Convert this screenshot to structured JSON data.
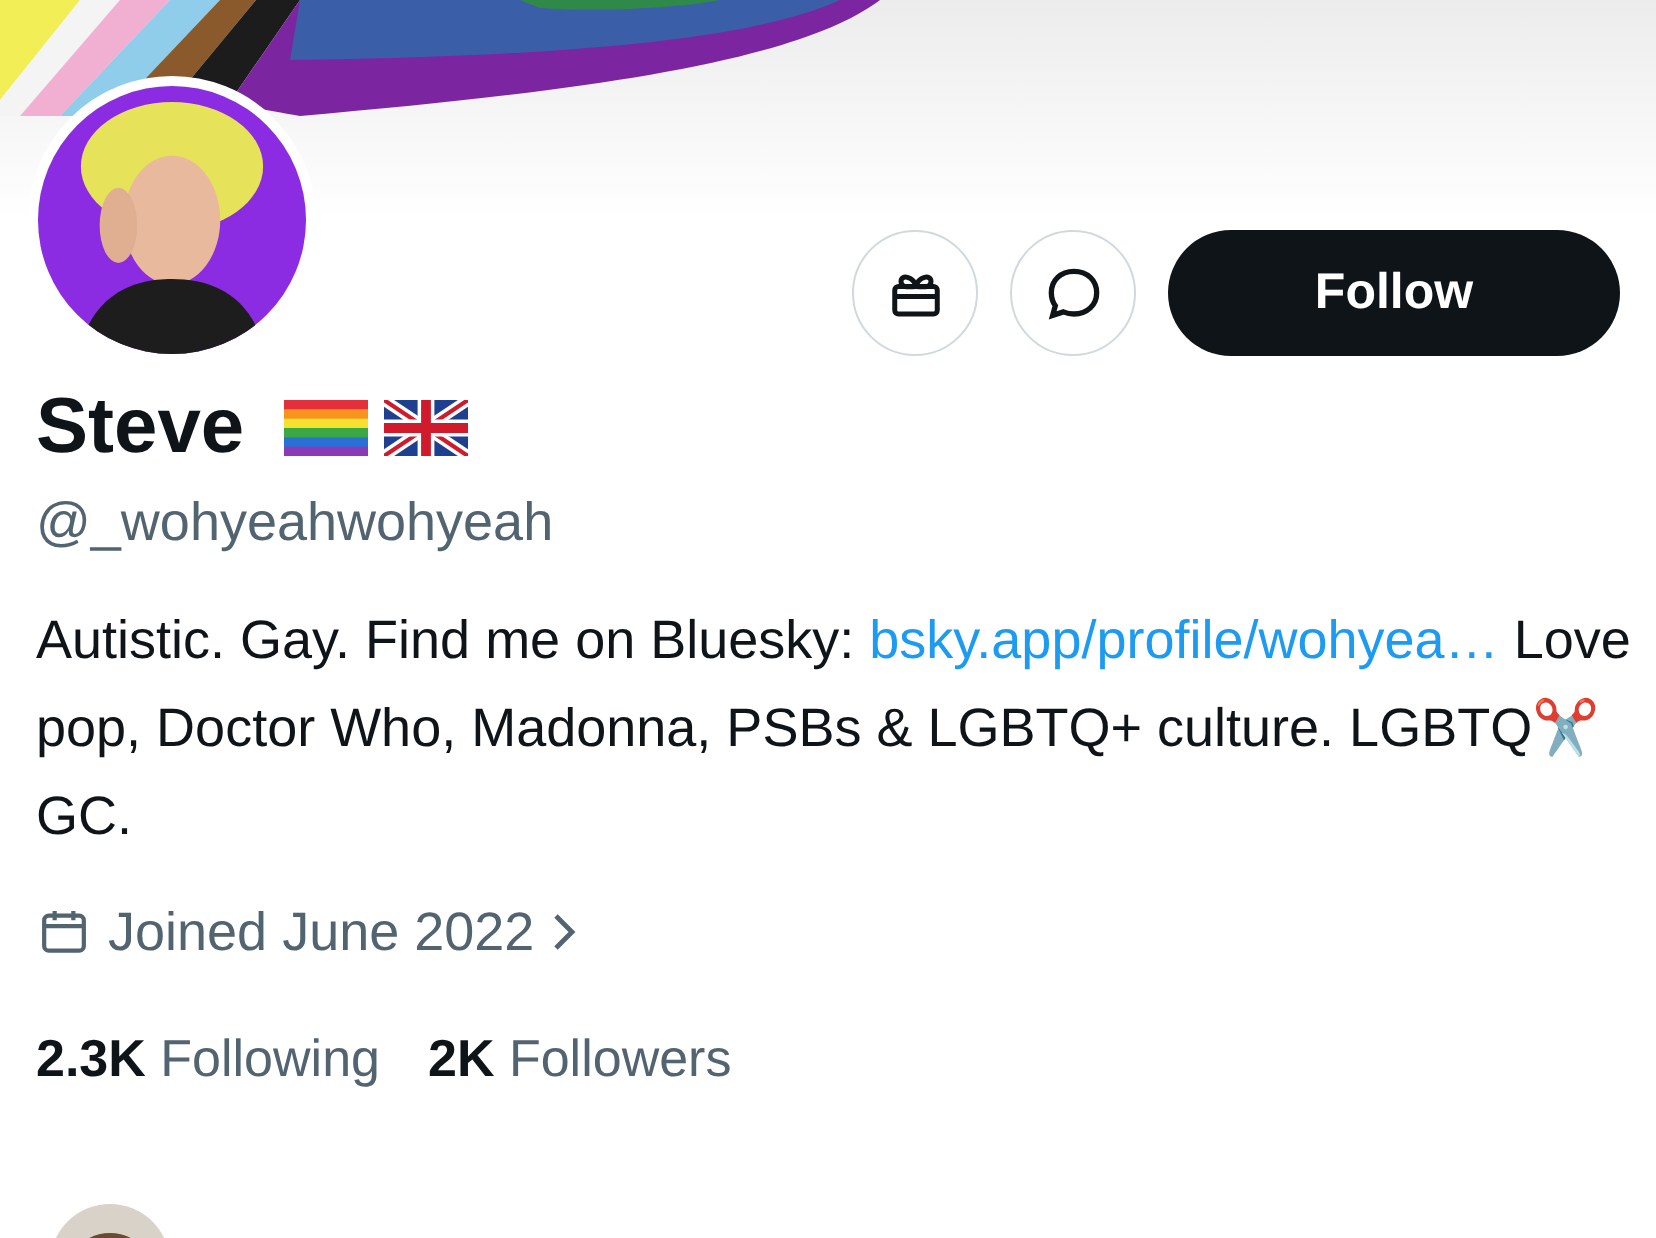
{
  "actions": [
    {
      "kind": "gift"
    },
    {
      "kind": "message"
    }
  ],
  "follow_button": "Follow",
  "profile": {
    "name": "Steve",
    "name_badges": [
      {
        "kind": "rainbow-flag"
      },
      {
        "kind": "uk-flag"
      }
    ],
    "handle": "@_wohyeahwohyeah",
    "bio": [
      {
        "kind": "text",
        "text": "Autistic. Gay. Find me on Bluesky: "
      },
      {
        "kind": "link",
        "text": "bsky.app/profile/wohyea…"
      },
      {
        "kind": "text",
        "text": " Love pop, Doctor Who, Madonna, PSBs & LGBTQ+ culture. LGBTQ✂️GC."
      }
    ],
    "joined": "Joined June 2022",
    "stats": [
      {
        "count": "2.3K",
        "label": "Following"
      },
      {
        "count": "2K",
        "label": "Followers"
      }
    ]
  }
}
